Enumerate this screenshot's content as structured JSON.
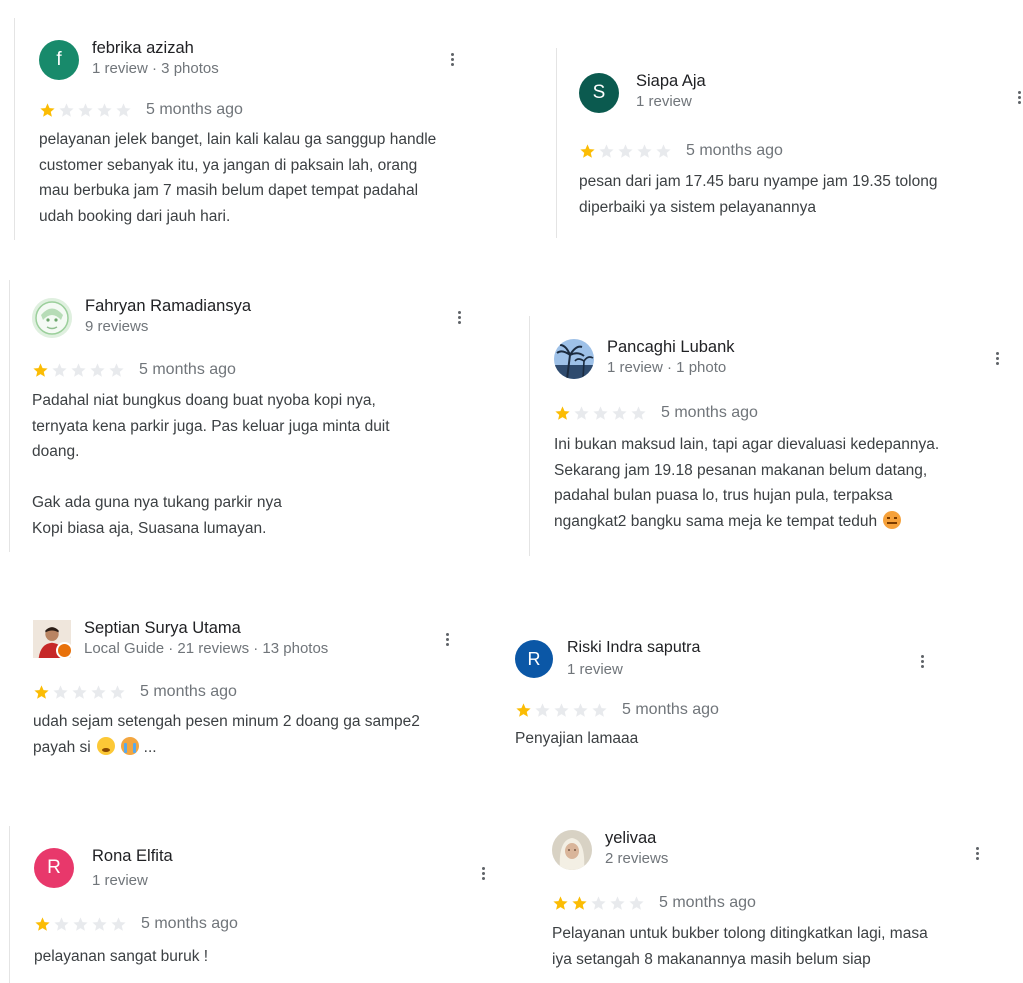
{
  "colors": {
    "star_filled": "#fbbc04",
    "star_empty": "#e8eaed",
    "name_text": "#202124",
    "meta_text": "#70757a",
    "body_text": "#3c4043"
  },
  "reviews": [
    {
      "id": "febrika",
      "avatar": {
        "type": "letter",
        "letter": "f",
        "color": "#188a6b"
      },
      "name": "febrika azizah",
      "meta": "1 review · 3 photos",
      "rating": 1,
      "time": "5 months ago",
      "text": "pelayanan jelek banget, lain kali kalau ga sanggup handle\ncustomer sebanyak itu, ya jangan di paksain lah, orang\nmau berbuka jam 7 masih belum dapet tempat padahal\nudah booking dari jauh hari.",
      "emojis": []
    },
    {
      "id": "siapa",
      "avatar": {
        "type": "letter",
        "letter": "S",
        "color": "#0b5a4f"
      },
      "name": "Siapa Aja",
      "meta": "1 review",
      "rating": 1,
      "time": "5 months ago",
      "text": "pesan dari jam 17.45 baru nyampe jam 19.35 tolong\ndiperbaiki ya sistem pelayanannya",
      "emojis": []
    },
    {
      "id": "fahryan",
      "avatar": {
        "type": "photo",
        "icon": "anime-portrait-icon"
      },
      "name": "Fahryan Ramadiansya",
      "meta": "9 reviews",
      "rating": 1,
      "time": "5 months ago",
      "text": "Padahal niat bungkus doang buat nyoba kopi nya,\nternyata kena parkir juga. Pas keluar juga minta duit\ndoang.\n\nGak ada guna nya tukang parkir nya\nKopi biasa aja, Suasana lumayan.",
      "emojis": []
    },
    {
      "id": "pancaghi",
      "avatar": {
        "type": "photo",
        "icon": "palm-tree-photo-icon"
      },
      "name": "Pancaghi Lubank",
      "meta": "1 review · 1 photo",
      "rating": 1,
      "time": "5 months ago",
      "text": "Ini bukan maksud lain, tapi agar dievaluasi kedepannya.\nSekarang jam 19.18 pesanan makanan belum datang,\npadahal bulan puasa lo, trus hujan pula, terpaksa\nngangkat2 bangku sama meja ke tempat teduh",
      "emojis": [
        "unamused-face-emoji"
      ]
    },
    {
      "id": "septian",
      "avatar": {
        "type": "photo",
        "icon": "person-photo-icon",
        "badge": "local-guide-badge-icon"
      },
      "name": "Septian Surya Utama",
      "meta": "Local Guide · 21 reviews · 13 photos",
      "rating": 1,
      "time": "5 months ago",
      "text": "udah sejam setengah pesen minum 2 doang ga sampe2\npayah si",
      "emojis": [
        "sad-face-emoji",
        "crying-face-emoji"
      ],
      "ellipsis": "..."
    },
    {
      "id": "riski",
      "avatar": {
        "type": "letter",
        "letter": "R",
        "color": "#0b57a6"
      },
      "name": "Riski Indra saputra",
      "meta": "1 review",
      "rating": 1,
      "time": "5 months ago",
      "text": "Penyajian lamaaa",
      "emojis": []
    },
    {
      "id": "rona",
      "avatar": {
        "type": "letter",
        "letter": "R",
        "color": "#e8386b"
      },
      "name": "Rona Elfita",
      "meta": "1 review",
      "rating": 1,
      "time": "5 months ago",
      "text": "pelayanan sangat buruk !",
      "emojis": []
    },
    {
      "id": "yelivaa",
      "avatar": {
        "type": "photo",
        "icon": "hijab-portrait-icon"
      },
      "name": "yelivaa",
      "meta": "2 reviews",
      "rating": 2,
      "time": "5 months ago",
      "text": "Pelayanan untuk bukber tolong ditingkatkan lagi, masa\niya setangah 8 makanannya masih belum siap",
      "emojis": []
    }
  ]
}
